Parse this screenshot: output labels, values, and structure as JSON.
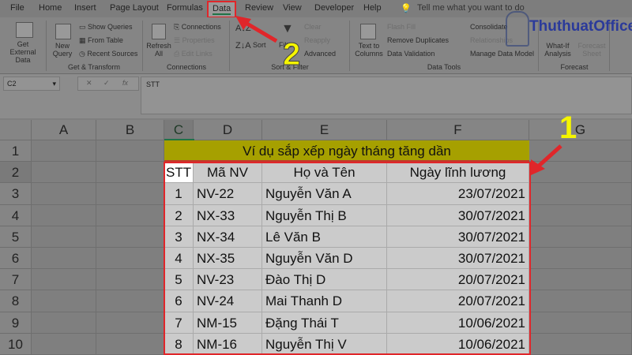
{
  "ribbon_tabs": [
    "File",
    "Home",
    "Insert",
    "Page Layout",
    "Formulas",
    "Data",
    "Review",
    "View",
    "Developer",
    "Help"
  ],
  "active_tab": "Data",
  "tell_me": "Tell me what you want to do",
  "logo": "ThuthuatOffice",
  "ribbon": {
    "get_external": "Get External Data",
    "new_query": "New Query",
    "show_queries": "Show Queries",
    "from_table": "From Table",
    "recent_sources": "Recent Sources",
    "grp_get_transform": "Get & Transform",
    "refresh_all": "Refresh All",
    "connections": "Connections",
    "properties": "Properties",
    "edit_links": "Edit Links",
    "grp_connections": "Connections",
    "sort": "Sort",
    "filter": "Filter",
    "clear": "Clear",
    "reapply": "Reapply",
    "advanced": "Advanced",
    "grp_sort_filter": "Sort & Filter",
    "text_to_columns": "Text to Columns",
    "flash_fill": "Flash Fill",
    "remove_duplicates": "Remove Duplicates",
    "data_validation": "Data Validation",
    "consolidate": "Consolidate",
    "relationships": "Relationships",
    "manage_data_model": "Manage Data Model",
    "grp_data_tools": "Data Tools",
    "what_if": "What-If Analysis",
    "forecast_sheet": "Forecast Sheet",
    "grp_forecast": "Forecast"
  },
  "name_box": "C2",
  "formula": "STT",
  "columns": [
    "A",
    "B",
    "C",
    "D",
    "E",
    "F",
    "G"
  ],
  "rows": [
    "1",
    "2",
    "3",
    "4",
    "5",
    "6",
    "7",
    "8",
    "9",
    "10"
  ],
  "sheet": {
    "title": "Ví dụ sắp xếp ngày tháng tăng dần",
    "headers": [
      "STT",
      "Mã NV",
      "Họ và Tên",
      "Ngày lĩnh lương"
    ],
    "data": [
      [
        "1",
        "NV-22",
        "Nguyễn Văn A",
        "23/07/2021"
      ],
      [
        "2",
        "NX-33",
        "Nguyễn Thị B",
        "30/07/2021"
      ],
      [
        "3",
        "NX-34",
        "Lê Văn B",
        "30/07/2021"
      ],
      [
        "4",
        "NX-35",
        "Nguyễn Văn D",
        "30/07/2021"
      ],
      [
        "5",
        "NV-23",
        "Đào Thị D",
        "20/07/2021"
      ],
      [
        "6",
        "NV-24",
        "Mai Thanh D",
        "20/07/2021"
      ],
      [
        "7",
        "NM-15",
        "Đặng Thái T",
        "10/06/2021"
      ],
      [
        "8",
        "NM-16",
        "Nguyễn Thị V",
        "10/06/2021"
      ]
    ]
  },
  "annotations": {
    "step1": "1",
    "step2": "2",
    "highlight_color": "#e0262a",
    "number_color": "#f5f500"
  }
}
